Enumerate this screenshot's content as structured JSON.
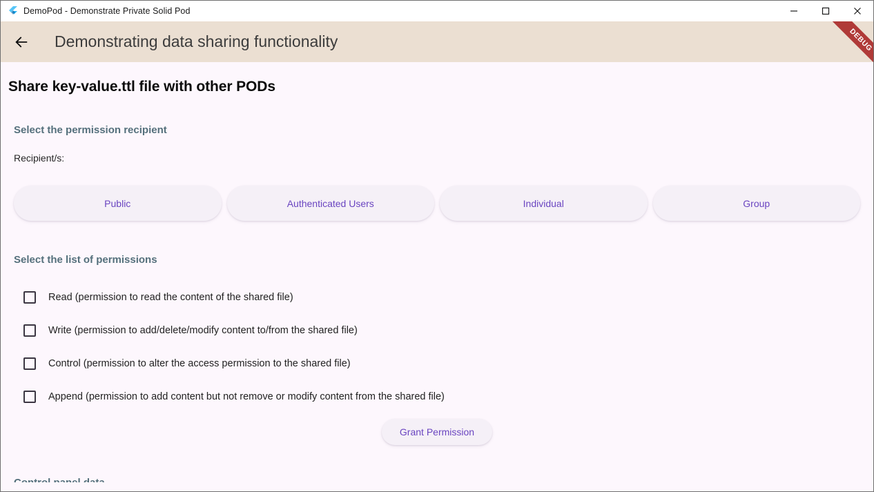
{
  "window": {
    "title": "DemoPod - Demonstrate Private Solid Pod",
    "app_icon": "flutter-logo-icon",
    "controls": {
      "minimize": "minimize-icon",
      "maximize": "maximize-icon",
      "close": "close-icon"
    }
  },
  "appbar": {
    "back_icon": "back-arrow-icon",
    "title": "Demonstrating data sharing functionality",
    "debug_banner": "DEBUG"
  },
  "page": {
    "title": "Share key-value.ttl file with other PODs"
  },
  "recipient": {
    "section_heading": "Select the permission recipient",
    "label": "Recipient/s:",
    "options": [
      {
        "label": "Public"
      },
      {
        "label": "Authenticated Users"
      },
      {
        "label": "Individual"
      },
      {
        "label": "Group"
      }
    ]
  },
  "permissions": {
    "section_heading": "Select the list of permissions",
    "items": [
      {
        "label": "Read (permission to read the content of the shared file)",
        "checked": false
      },
      {
        "label": "Write (permission to add/delete/modify content to/from the shared file)",
        "checked": false
      },
      {
        "label": "Control (permission to alter the access permission to the shared file)",
        "checked": false
      },
      {
        "label": "Append (permission to add content but not remove or modify content from the shared file)",
        "checked": false
      }
    ],
    "grant_button": "Grant Permission"
  },
  "next_section": {
    "heading": "Control panel data"
  },
  "colors": {
    "appbar_bg": "#ebdfd2",
    "page_bg": "#fdf7fd",
    "accent_purple": "#6a45c0",
    "section_heading": "#55707c",
    "debug_red": "#b03a38",
    "pill_bg": "#f5f0f7"
  }
}
